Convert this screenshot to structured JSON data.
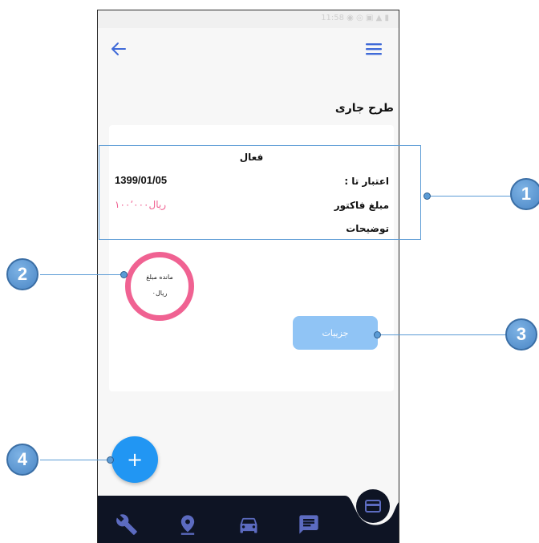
{
  "status_bar": {
    "text": "11:58 ◉ ◎ ▣ ▲ ▮"
  },
  "header": {
    "back_icon": "arrow-left-icon",
    "menu_icon": "hamburger-menu-icon"
  },
  "page": {
    "section_title": "طرح جاری"
  },
  "plan_card": {
    "status": "فعال",
    "valid_until_label": "اعتبار تا :",
    "valid_until_value": "1399/01/05",
    "invoice_amount_label": "مبلغ فاکتور",
    "invoice_amount_value": "ریال۱۰۰٬۰۰۰",
    "description_label": "توضیحات"
  },
  "remaining": {
    "title": "مانده مبلغ",
    "value": "ریال۰",
    "ring_color": "#f06292"
  },
  "details_button": {
    "label": "جزییات",
    "color": "#90c4f5"
  },
  "fab": {
    "label": "+",
    "color": "#2196f3"
  },
  "bottom_nav": {
    "items": [
      {
        "name": "wrench-icon"
      },
      {
        "name": "location-pin-icon"
      },
      {
        "name": "car-icon"
      },
      {
        "name": "chat-icon"
      }
    ],
    "active": {
      "name": "credit-card-icon"
    },
    "background": "#0e1424",
    "icon_color": "#5c6bc0"
  },
  "callouts": [
    "1",
    "2",
    "3",
    "4"
  ],
  "accent_color": "#5b9bd5"
}
